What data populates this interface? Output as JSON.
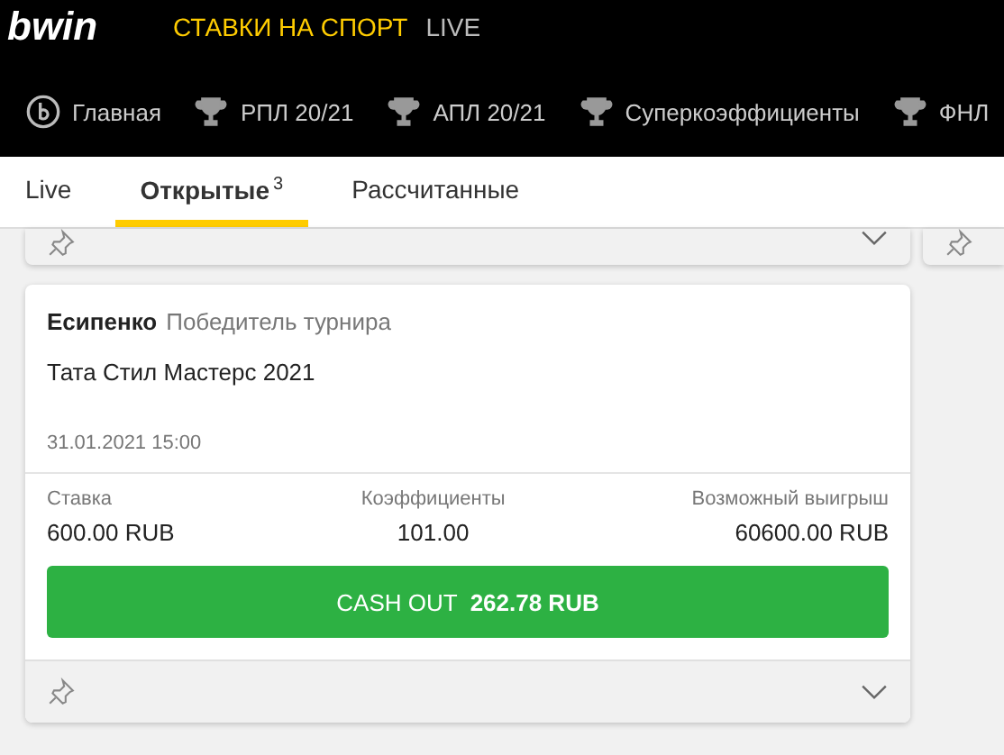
{
  "header": {
    "logo": "bwin",
    "nav": [
      {
        "label": "СТАВКИ НА СПОРТ",
        "selected": true
      },
      {
        "label": "LIVE",
        "selected": false
      }
    ]
  },
  "sports_nav": [
    {
      "label": "Главная",
      "kind": "home"
    },
    {
      "label": "РПЛ 20/21",
      "kind": "trophy"
    },
    {
      "label": "АПЛ 20/21",
      "kind": "trophy"
    },
    {
      "label": "Суперкоэффициенты",
      "kind": "trophy"
    },
    {
      "label": "ФНЛ",
      "kind": "trophy"
    }
  ],
  "tabs": [
    {
      "label": "Live",
      "selected": false
    },
    {
      "label": "Открытые",
      "count": "3",
      "selected": true
    },
    {
      "label": "Рассчитанные",
      "selected": false
    }
  ],
  "bet": {
    "selection": "Есипенко",
    "market": "Победитель турнира",
    "event": "Тата Стил Мастерс 2021",
    "date": "31.01.2021 15:00",
    "fields": [
      {
        "label": "Ставка",
        "value": "600.00 RUB"
      },
      {
        "label": "Коэффициенты",
        "value": "101.00"
      },
      {
        "label": "Возможный выигрыш",
        "value": "60600.00 RUB"
      }
    ],
    "cashout": "CASH OUT  **262.78 RUB**"
  }
}
